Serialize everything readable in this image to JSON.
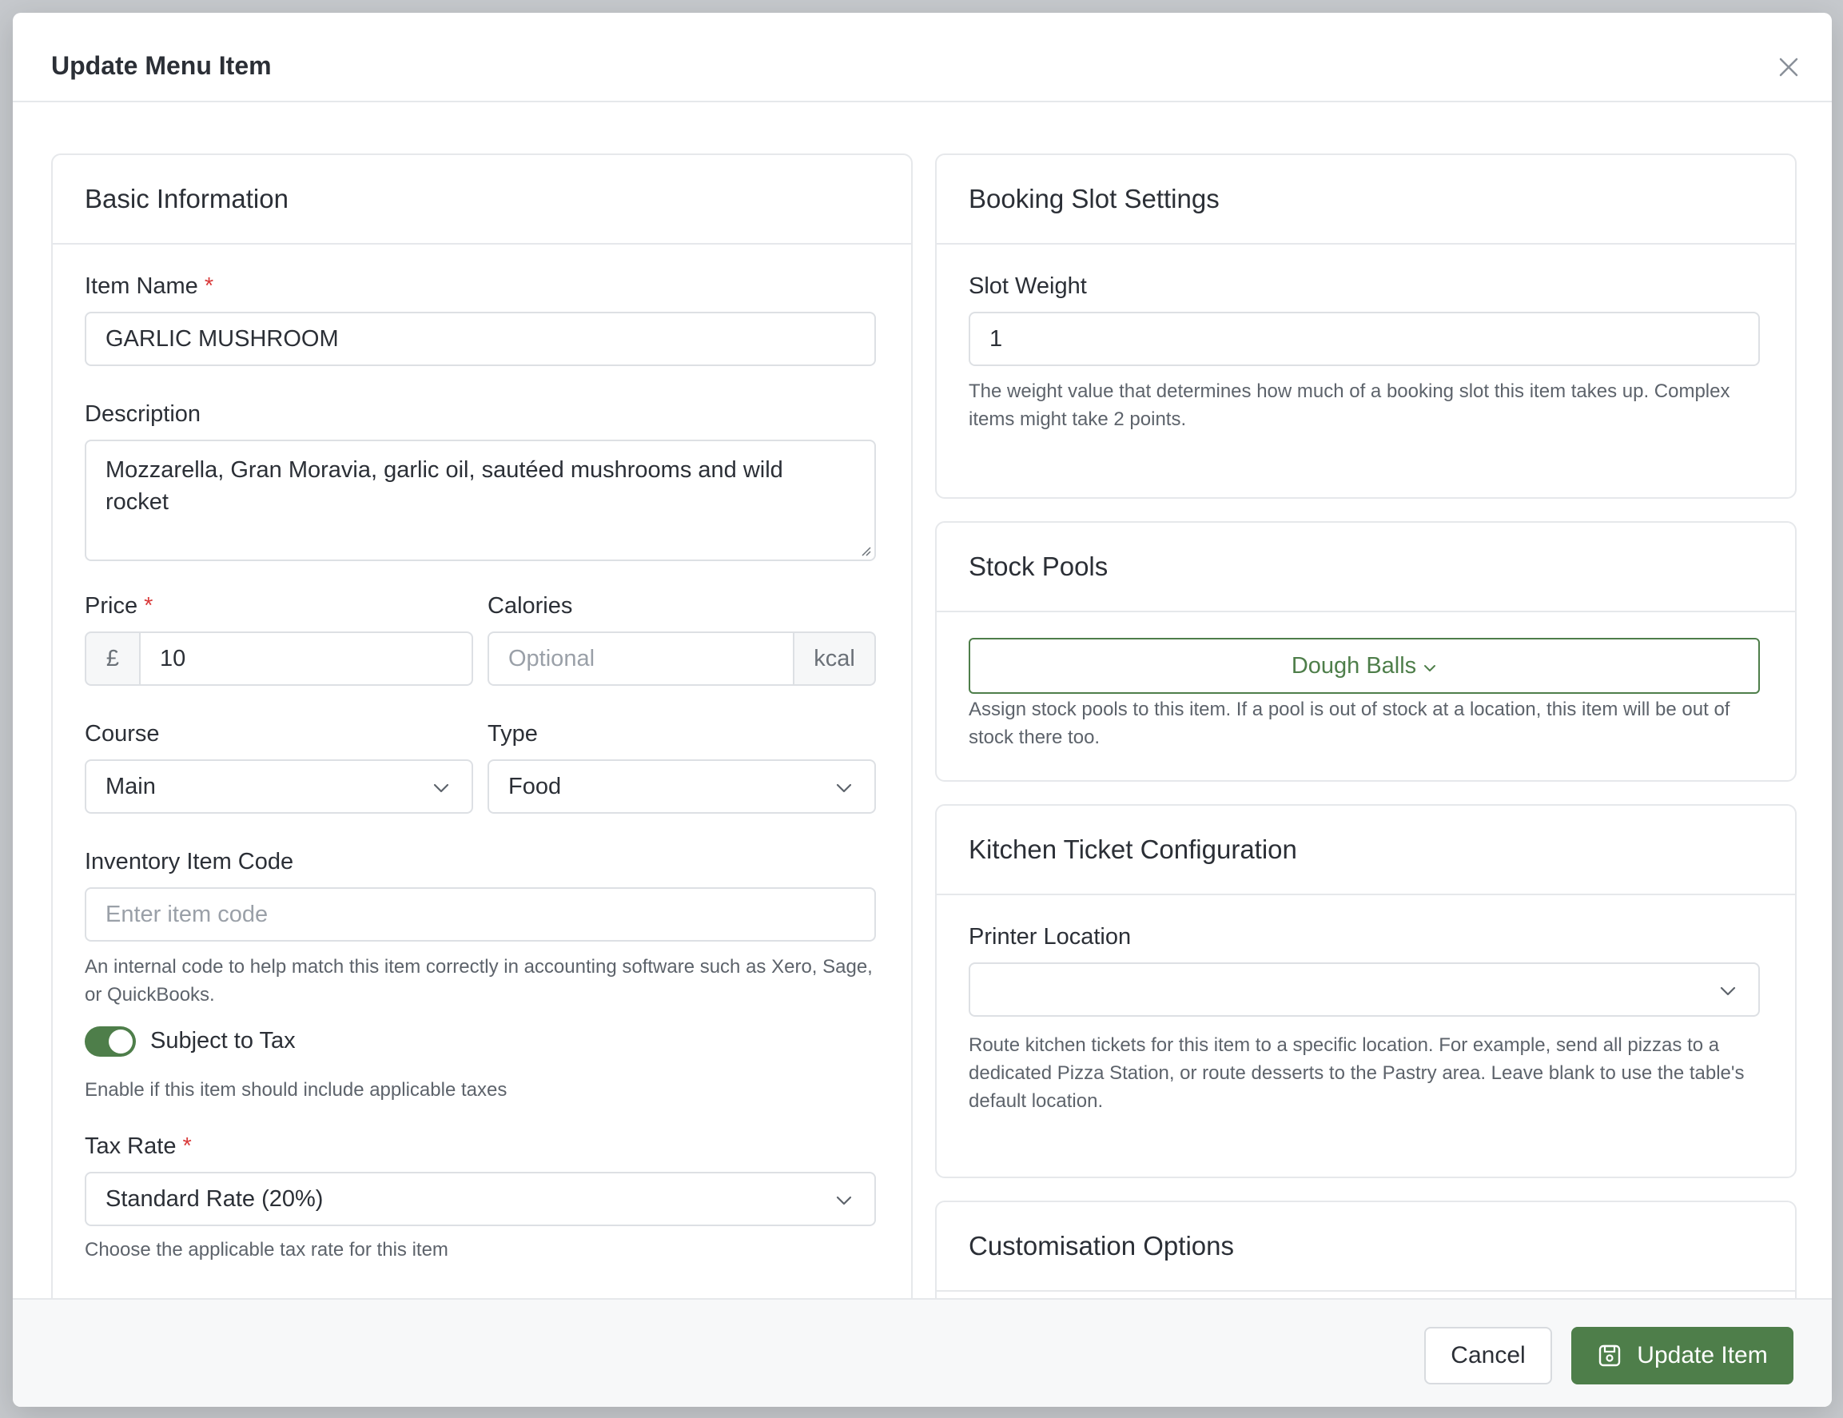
{
  "modal": {
    "title": "Update Menu Item"
  },
  "basic": {
    "title": "Basic Information",
    "item_name_label": "Item Name",
    "item_name_value": "GARLIC MUSHROOM",
    "description_label": "Description",
    "description_value": "Mozzarella, Gran Moravia, garlic oil, sautéed mushrooms and wild rocket",
    "price_label": "Price",
    "price_currency": "£",
    "price_value": "10",
    "calories_label": "Calories",
    "calories_placeholder": "Optional",
    "calories_unit": "kcal",
    "course_label": "Course",
    "course_value": "Main",
    "type_label": "Type",
    "type_value": "Food",
    "inventory_label": "Inventory Item Code",
    "inventory_placeholder": "Enter item code",
    "inventory_help": "An internal code to help match this item correctly in accounting software such as Xero, Sage, or QuickBooks.",
    "tax_toggle_label": "Subject to Tax",
    "tax_toggle_on": true,
    "tax_toggle_help": "Enable if this item should include applicable taxes",
    "tax_rate_label": "Tax Rate",
    "tax_rate_value": "Standard Rate (20%)",
    "tax_rate_help": "Choose the applicable tax rate for this item",
    "required_mark": "*"
  },
  "booking": {
    "title": "Booking Slot Settings",
    "slot_weight_label": "Slot Weight",
    "slot_weight_value": "1",
    "slot_weight_help": "The weight value that determines how much of a booking slot this item takes up. Complex items might take 2 points."
  },
  "stock": {
    "title": "Stock Pools",
    "selected_pool": "Dough Balls",
    "help": "Assign stock pools to this item. If a pool is out of stock at a location, this item will be out of stock there too."
  },
  "kitchen": {
    "title": "Kitchen Ticket Configuration",
    "printer_label": "Printer Location",
    "printer_value": "",
    "help": "Route kitchen tickets for this item to a specific location. For example, send all pizzas to a dedicated Pizza Station, or route desserts to the Pastry area. Leave blank to use the table's default location."
  },
  "customisation": {
    "title": "Customisation Options"
  },
  "footer": {
    "cancel_label": "Cancel",
    "submit_label": "Update Item"
  },
  "colors": {
    "accent": "#4e7e4a",
    "required": "#d93a3a"
  },
  "icons": {
    "close": "close-icon",
    "chevron": "chevron-down-icon",
    "save": "save-icon"
  }
}
